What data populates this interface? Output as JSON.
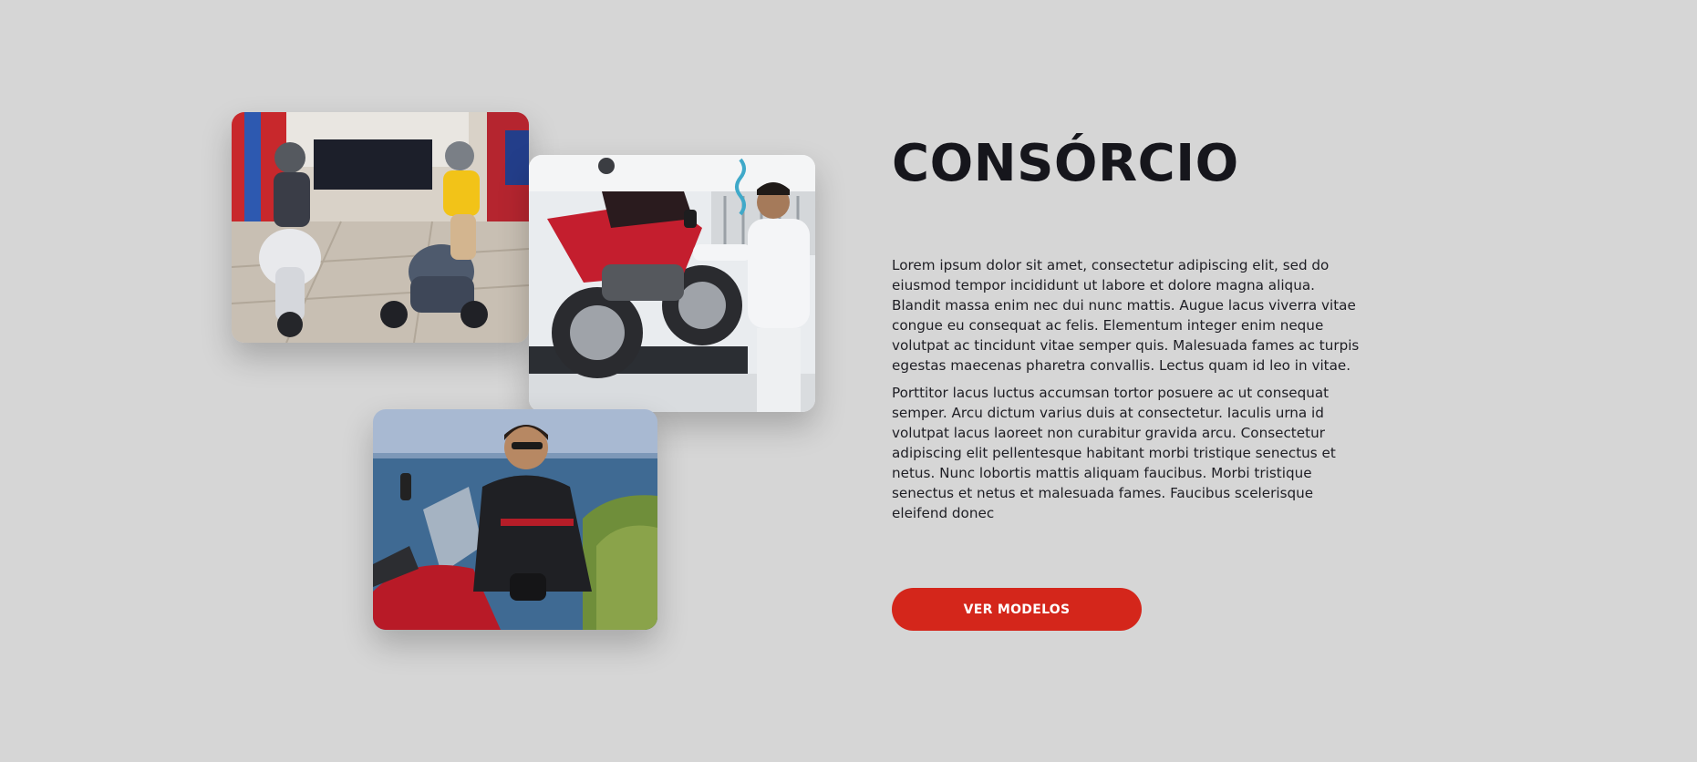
{
  "section": {
    "title": "CONSÓRCIO",
    "paragraphs": [
      "Lorem ipsum dolor sit amet, consectetur adipiscing elit, sed do eiusmod tempor incididunt ut labore et dolore magna aliqua. Blandit massa enim nec dui nunc mattis. Augue lacus viverra vitae congue eu consequat ac felis. Elementum integer enim neque volutpat ac tincidunt vitae semper quis. Malesuada fames ac turpis egestas maecenas pharetra convallis. Lectus quam id leo in vitae.",
      "Porttitor lacus luctus accumsan tortor posuere ac ut consequat semper. Arcu dictum varius duis at consectetur. Iaculis urna id volutpat lacus laoreet non curabitur gravida arcu. Consectetur adipiscing elit pellentesque habitant morbi tristique senectus et netus. Nunc lobortis mattis aliquam faucibus. Morbi tristique senectus et netus et malesuada fames. Faucibus scelerisque eleifend donec"
    ],
    "cta_label": "VER MODELOS"
  },
  "colors": {
    "background": "#d6d6d6",
    "title": "#16161c",
    "body_text": "#1e1e24",
    "cta_background": "#d4261b",
    "cta_text": "#ffffff"
  }
}
